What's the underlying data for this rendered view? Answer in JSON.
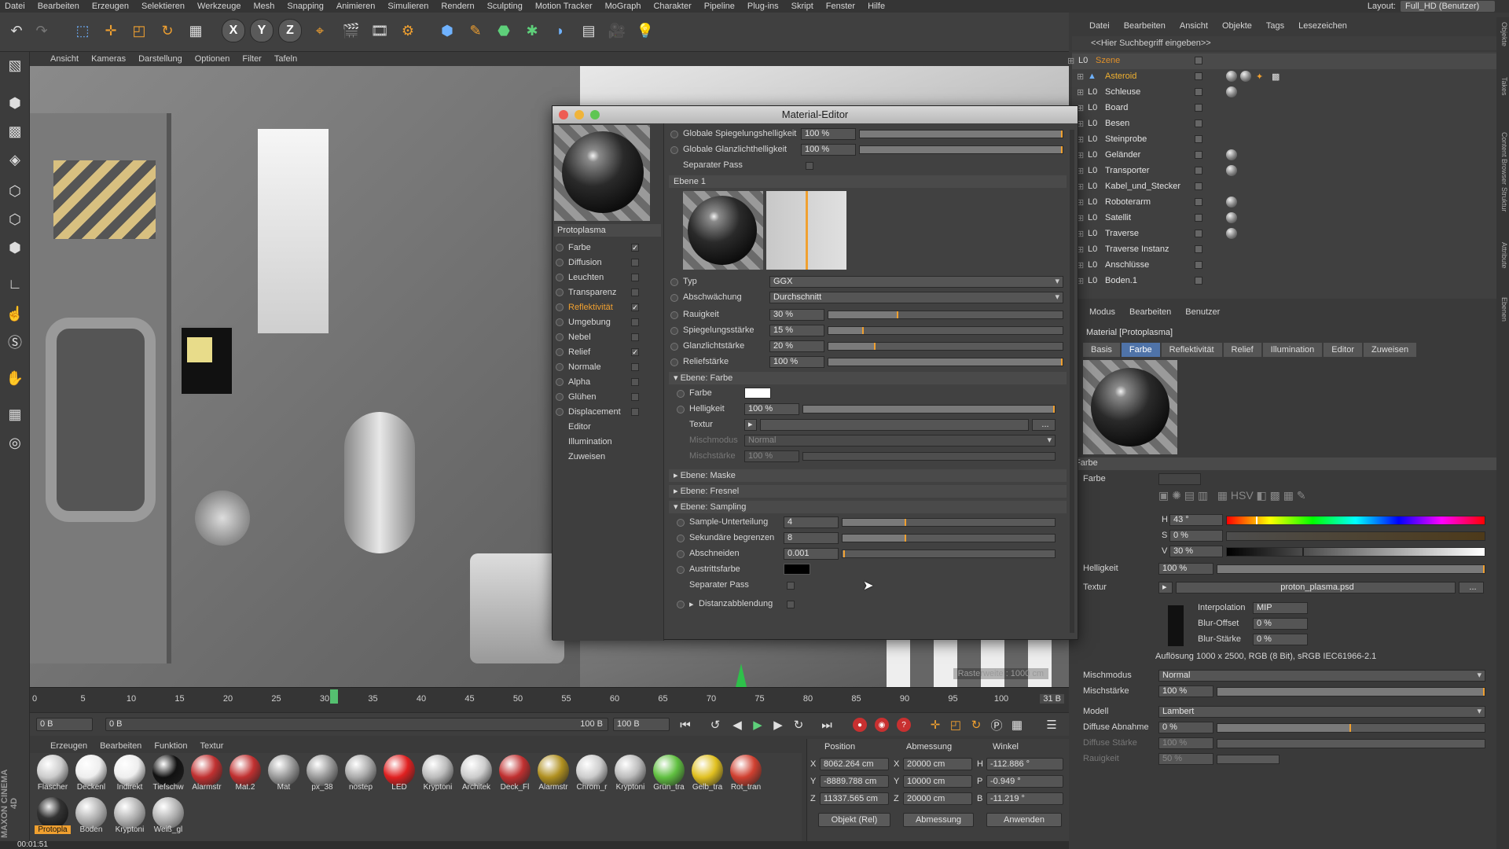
{
  "menubar": [
    "Datei",
    "Bearbeiten",
    "Erzeugen",
    "Selektieren",
    "Werkzeuge",
    "Mesh",
    "Snapping",
    "Animieren",
    "Simulieren",
    "Rendern",
    "Sculpting",
    "Motion Tracker",
    "MoGraph",
    "Charakter",
    "Pipeline",
    "Plug-ins",
    "Skript",
    "Fenster",
    "Hilfe"
  ],
  "layout": {
    "label": "Layout:",
    "value": "Full_HD (Benutzer)"
  },
  "toolbar": {
    "x": "X",
    "y": "Y",
    "z": "Z"
  },
  "viewport": {
    "menu": [
      "Ansicht",
      "Kameras",
      "Darstellung",
      "Optionen",
      "Filter",
      "Tafeln"
    ],
    "raster": "Rasterweite : 1000 cm"
  },
  "timeline": {
    "ticks": [
      "0",
      "5",
      "10",
      "15",
      "20",
      "25",
      "30",
      "35",
      "40",
      "45",
      "50",
      "55",
      "60",
      "65",
      "70",
      "75",
      "80",
      "85",
      "90",
      "95",
      "100"
    ],
    "current": "31",
    "end": "31 B"
  },
  "transport": {
    "start": "0 B",
    "range_start": "0 B",
    "range_end": "100 B",
    "end": "100 B"
  },
  "material_manager": {
    "menu": [
      "Erzeugen",
      "Bearbeiten",
      "Funktion",
      "Textur"
    ],
    "row1": [
      "Flascher",
      "Deckenl",
      "Indirekt",
      "Tiefschw",
      "Alarmstr",
      "Mat.2",
      "Mat",
      "px_38",
      "nostep",
      "LED",
      "Kryptoni",
      "Architek",
      "Deck_Fl",
      "Alarmstr",
      "Chrom_r",
      "Kryptoni",
      "Grün_tra",
      "Gelb_tra",
      "Rot_tran"
    ],
    "row2": [
      "Protopla",
      "Boden",
      "Kryptoni",
      "Weiß_gl"
    ],
    "brand": "MAXON CINEMA 4D"
  },
  "coord": {
    "headers": [
      "Position",
      "Abmessung",
      "Winkel"
    ],
    "pos": [
      "8062.264 cm",
      "-8889.788 cm",
      "11337.565 cm"
    ],
    "size": [
      "20000 cm",
      "10000 cm",
      "20000 cm"
    ],
    "rot": [
      "-112.886 °",
      "-0.949 °",
      "-11.219 °"
    ],
    "axes": [
      "X",
      "Y",
      "Z"
    ],
    "size_axes": [
      "X",
      "Y",
      "Z"
    ],
    "rot_axes": [
      "H",
      "P",
      "B"
    ],
    "mode": "Objekt (Rel)",
    "size_mode": "Abmessung",
    "apply": "Anwenden"
  },
  "timecode": "00:01:51",
  "material_editor": {
    "title": "Material-Editor",
    "name": "Protoplasma",
    "channels": [
      {
        "label": "Farbe",
        "checked": true
      },
      {
        "label": "Diffusion",
        "checked": false
      },
      {
        "label": "Leuchten",
        "checked": false
      },
      {
        "label": "Transparenz",
        "checked": false
      },
      {
        "label": "Reflektivität",
        "checked": true
      },
      {
        "label": "Umgebung",
        "checked": false
      },
      {
        "label": "Nebel",
        "checked": false
      },
      {
        "label": "Relief",
        "checked": true
      },
      {
        "label": "Normale",
        "checked": false
      },
      {
        "label": "Alpha",
        "checked": false
      },
      {
        "label": "Glühen",
        "checked": false
      },
      {
        "label": "Displacement",
        "checked": false
      }
    ],
    "extra": [
      "Editor",
      "Illumination",
      "Zuweisen"
    ],
    "global_spec_label": "Globale Spiegelungshelligkeit",
    "global_spec": "100 %",
    "global_spec_fill": 1.0,
    "global_gloss_label": "Globale Glanzlichthelligkeit",
    "global_gloss": "100 %",
    "global_gloss_fill": 1.0,
    "separate_pass_label": "Separater Pass",
    "layer_label": "Ebene 1",
    "type_label": "Typ",
    "type": "GGX",
    "attenuation_label": "Abschwächung",
    "attenuation": "Durchschnitt",
    "roughness_label": "Rauigkeit",
    "roughness": "30 %",
    "roughness_fill": 0.3,
    "spec_strength_label": "Spiegelungsstärke",
    "spec_strength": "15 %",
    "spec_strength_fill": 0.15,
    "gloss_strength_label": "Glanzlichtstärke",
    "gloss_strength": "20 %",
    "gloss_strength_fill": 0.2,
    "relief_strength_label": "Reliefstärke",
    "relief_strength": "100 %",
    "relief_strength_fill": 1.0,
    "sect_color": "Ebene: Farbe",
    "color_label": "Farbe",
    "color_value": "#ffffff",
    "brightness_label": "Helligkeit",
    "brightness": "100 %",
    "brightness_fill": 1.0,
    "texture_label": "Textur",
    "mix_mode_label": "Mischmodus",
    "mix_mode": "Normal",
    "mix_strength_label": "Mischstärke",
    "mix_strength": "100 %",
    "sect_mask": "Ebene: Maske",
    "sect_fresnel": "Ebene: Fresnel",
    "sect_sampling": "Ebene: Sampling",
    "sample_sub_label": "Sample-Unterteilung",
    "sample_sub": "4",
    "sample_sub_fill": 0.3,
    "secondary_label": "Sekundäre begrenzen",
    "secondary": "8",
    "secondary_fill": 0.3,
    "cutoff_label": "Abschneiden",
    "cutoff": "0.001",
    "cutoff_fill": 0.01,
    "exit_color_label": "Austrittsfarbe",
    "exit_color": "#000000",
    "sep_pass2_label": "Separater Pass",
    "distance_label": "Distanzabblendung"
  },
  "object_manager": {
    "menu": [
      "Datei",
      "Bearbeiten",
      "Ansicht",
      "Objekte",
      "Tags",
      "Lesezeichen"
    ],
    "search": "<<Hier Suchbegriff eingeben>>",
    "objects": [
      {
        "name": "Szene",
        "color": "#e0902a",
        "mat": false
      },
      {
        "name": "Asteroid",
        "color": "#f0b030",
        "mat": true
      },
      {
        "name": "Schleuse",
        "color": "#e2e2e2",
        "mat": true
      },
      {
        "name": "Board",
        "color": "#e2e2e2",
        "mat": false
      },
      {
        "name": "Besen",
        "color": "#e2e2e2",
        "mat": false
      },
      {
        "name": "Steinprobe",
        "color": "#e2e2e2",
        "mat": false
      },
      {
        "name": "Geländer",
        "color": "#e2e2e2",
        "mat": true
      },
      {
        "name": "Transporter",
        "color": "#e2e2e2",
        "mat": true
      },
      {
        "name": "Kabel_und_Stecker",
        "color": "#e2e2e2",
        "mat": false
      },
      {
        "name": "Roboterarm",
        "color": "#e2e2e2",
        "mat": true
      },
      {
        "name": "Satellit",
        "color": "#e2e2e2",
        "mat": true
      },
      {
        "name": "Traverse",
        "color": "#e2e2e2",
        "mat": true
      },
      {
        "name": "Traverse Instanz",
        "color": "#e2e2e2",
        "mat": false
      },
      {
        "name": "Anschlüsse",
        "color": "#e2e2e2",
        "mat": false
      },
      {
        "name": "Boden.1",
        "color": "#e2e2e2",
        "mat": false
      }
    ]
  },
  "attribute_manager": {
    "menu": [
      "Modus",
      "Bearbeiten",
      "Benutzer"
    ],
    "title": "Material [Protoplasma]",
    "tabs": [
      "Basis",
      "Farbe",
      "Reflektivität",
      "Relief",
      "Illumination",
      "Editor",
      "Zuweisen"
    ],
    "active_tab": "Farbe",
    "section": "Farbe",
    "color_label": "Farbe",
    "h_label": "H",
    "h": "43 °",
    "h_fill": 0.12,
    "s_label": "S",
    "s": "0 %",
    "s_fill": 0.0,
    "v_label": "V",
    "v": "30 %",
    "v_fill": 0.3,
    "brightness_label": "Helligkeit",
    "brightness": "100 %",
    "texture_label": "Textur",
    "texture": "proton_plasma.psd",
    "interp_label": "Interpolation",
    "interp": "MIP",
    "blur_offset_label": "Blur-Offset",
    "blur_offset": "0 %",
    "blur_strength_label": "Blur-Stärke",
    "blur_strength": "0 %",
    "resolution": "Auflösung 1000 x 2500, RGB (8 Bit), sRGB IEC61966-2.1",
    "mix_mode_label": "Mischmodus",
    "mix_mode": "Normal",
    "mix_strength_label": "Mischstärke",
    "mix_strength": "100 %",
    "model_label": "Modell",
    "model": "Lambert",
    "diffuse_falloff_label": "Diffuse Abnahme",
    "diffuse_falloff": "0 %",
    "diffuse_falloff_fill": 0.5,
    "diffuse_strength_label": "Diffuse Stärke",
    "diffuse_strength": "100 %",
    "roughness_label": "Rauigkeit",
    "roughness": "50 %"
  },
  "right_strip": [
    "Objekte",
    "Takes",
    "Content Browser",
    "Struktur",
    "Attribute",
    "Ebenen"
  ],
  "colors": {
    "accent": "#f0a030",
    "tab_active": "#4f73a8",
    "bg": "#404040"
  }
}
